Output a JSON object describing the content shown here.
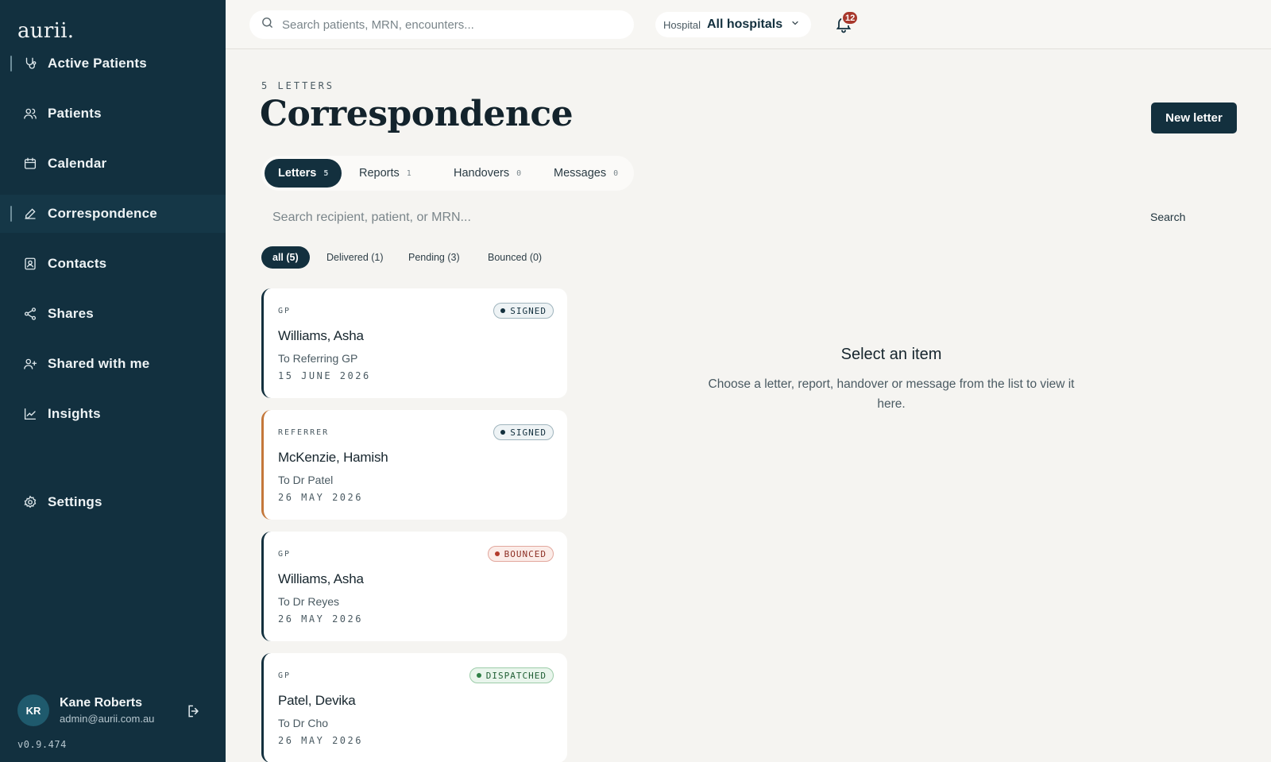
{
  "app": {
    "logo": "aurii."
  },
  "sidebar": {
    "items": [
      {
        "label": "Active Patients",
        "icon": "stethoscope-icon"
      },
      {
        "label": "Patients",
        "icon": "users-icon"
      },
      {
        "label": "Calendar",
        "icon": "calendar-icon"
      },
      {
        "label": "Correspondence",
        "icon": "pen-icon"
      },
      {
        "label": "Contacts",
        "icon": "contact-card-icon"
      },
      {
        "label": "Shares",
        "icon": "share-icon"
      },
      {
        "label": "Shared with me",
        "icon": "user-plus-icon"
      },
      {
        "label": "Insights",
        "icon": "line-chart-icon"
      },
      {
        "label": "Settings",
        "icon": "gear-icon"
      }
    ],
    "user": {
      "initials": "KR",
      "name": "Kane Roberts",
      "email": "admin@aurii.com.au"
    },
    "version": "v0.9.474"
  },
  "topbar": {
    "search_placeholder": "Search patients, MRN, encounters...",
    "hospital_label": "Hospital",
    "hospital_value": "All hospitals",
    "notifications_count": "12"
  },
  "page": {
    "eyebrow": "5 LETTERS",
    "title": "Correspondence",
    "new_button": "New letter",
    "tabs": [
      {
        "label": "Letters",
        "count": "5"
      },
      {
        "label": "Reports",
        "count": "1"
      },
      {
        "label": "Handovers",
        "count": "0"
      },
      {
        "label": "Messages",
        "count": "0"
      }
    ],
    "search_placeholder": "Search recipient, patient, or MRN...",
    "search_button": "Search",
    "filters": [
      "all (5)",
      "Delivered (1)",
      "Pending (3)",
      "Bounced (0)"
    ],
    "letters": [
      {
        "kind": "GP",
        "status": "SIGNED",
        "name": "Williams, Asha",
        "to": "To Referring GP",
        "date": "15 JUNE 2026"
      },
      {
        "kind": "REFERRER",
        "status": "SIGNED",
        "name": "McKenzie, Hamish",
        "to": "To Dr Patel",
        "date": "26 MAY 2026"
      },
      {
        "kind": "GP",
        "status": "BOUNCED",
        "name": "Williams, Asha",
        "to": "To Dr Reyes",
        "date": "26 MAY 2026"
      },
      {
        "kind": "GP",
        "status": "DISPATCHED",
        "name": "Patel, Devika",
        "to": "To Dr Cho",
        "date": "26 MAY 2026"
      }
    ],
    "empty_state": {
      "title": "Select an item",
      "description": "Choose a letter, report, handover or message from the list to view it here."
    }
  },
  "colors": {
    "sidebar_bg": "#12303f",
    "primary": "#13303e",
    "accent_orange": "#c4773a",
    "bounced": "#b33b2c",
    "dispatched": "#2f7f46"
  }
}
